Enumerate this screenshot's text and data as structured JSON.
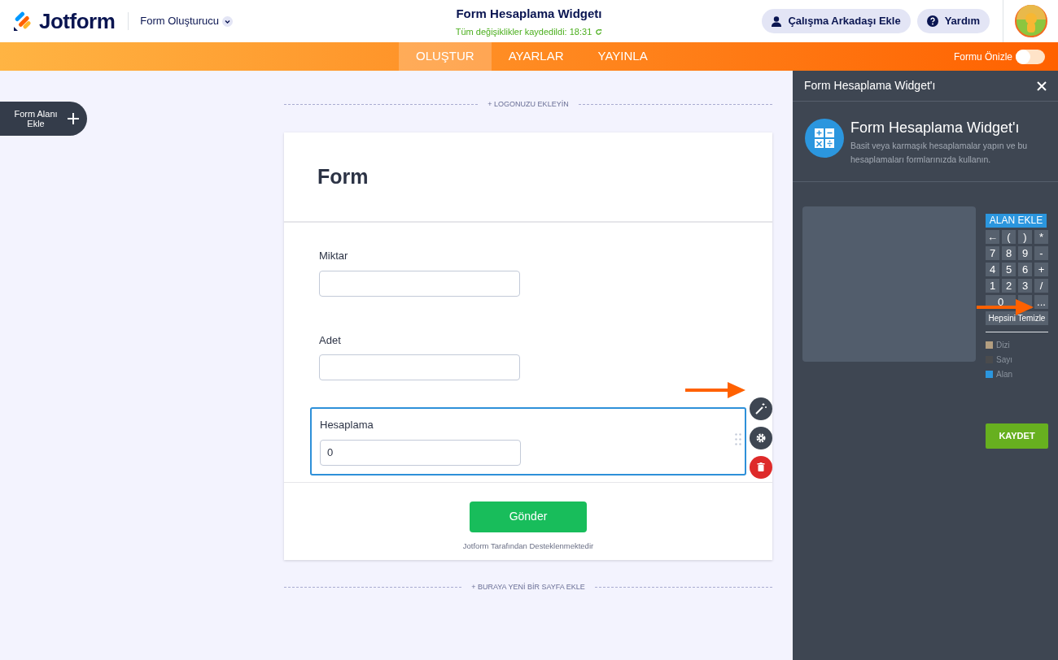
{
  "header": {
    "logo": "Jotform",
    "builder_menu": "Form Oluşturucu",
    "title": "Form Hesaplama Widgetı",
    "save_status": "Tüm değişiklikler kaydedildi: 18:31",
    "buttons": [
      {
        "kind": "person",
        "label": "Çalışma Arkadaşı Ekle"
      },
      {
        "kind": "help",
        "label": "Yardım"
      }
    ]
  },
  "nav": {
    "tabs": [
      {
        "label": "OLUŞTUR",
        "selected": true
      },
      {
        "label": "AYARLAR",
        "selected": false
      },
      {
        "label": "YAYINLA",
        "selected": false
      }
    ],
    "preview": {
      "label": "Formu Önizle",
      "on": false
    }
  },
  "add_field_button": "Form Alanı Ekle",
  "form": {
    "add_logo": "+ LOGONUZU EKLEYİN",
    "title": "Form",
    "fields": [
      {
        "label": "Miktar",
        "selected": false
      },
      {
        "label": "Adet",
        "selected": false
      },
      {
        "label": "Hesaplama",
        "value": "0",
        "selected": true
      }
    ],
    "submit": "Gönder",
    "footer": "Jotform Tarafından Desteklenmektedir",
    "add_page": "+ BURAYA YENİ BİR SAYFA EKLE"
  },
  "panel": {
    "title": "Form Hesaplama Widget'ı",
    "widget_name": "Form Hesaplama Widget'ı",
    "description": "Basit veya karmaşık hesaplamalar yapın ve bu hesaplamaları formlarınızda kullanın.",
    "add_field": "ALAN EKLE",
    "keys": [
      {
        "kind": "key",
        "label": "←"
      },
      {
        "kind": "key",
        "label": "("
      },
      {
        "kind": "key",
        "label": ")"
      },
      {
        "kind": "key",
        "label": "*"
      },
      {
        "kind": "key",
        "label": "7"
      },
      {
        "kind": "key",
        "label": "8"
      },
      {
        "kind": "key",
        "label": "9"
      },
      {
        "kind": "key",
        "label": "-"
      },
      {
        "kind": "key",
        "label": "4"
      },
      {
        "kind": "key",
        "label": "5"
      },
      {
        "kind": "key",
        "label": "6"
      },
      {
        "kind": "key",
        "label": "+"
      },
      {
        "kind": "key",
        "label": "1"
      },
      {
        "kind": "key",
        "label": "2"
      },
      {
        "kind": "key",
        "label": "3"
      },
      {
        "kind": "key",
        "label": "/"
      },
      {
        "kind": "wide",
        "label": "0"
      },
      {
        "kind": "blank"
      },
      {
        "kind": "key",
        "label": "..."
      }
    ],
    "clear_all": "Hepsini Temizle",
    "legend": [
      {
        "label": "Dizi",
        "color": "#b39e80"
      },
      {
        "label": "Sayı",
        "color": "#4a4b4d"
      },
      {
        "label": "Alan",
        "color": "#2b96de"
      }
    ],
    "save": "KAYDET"
  }
}
